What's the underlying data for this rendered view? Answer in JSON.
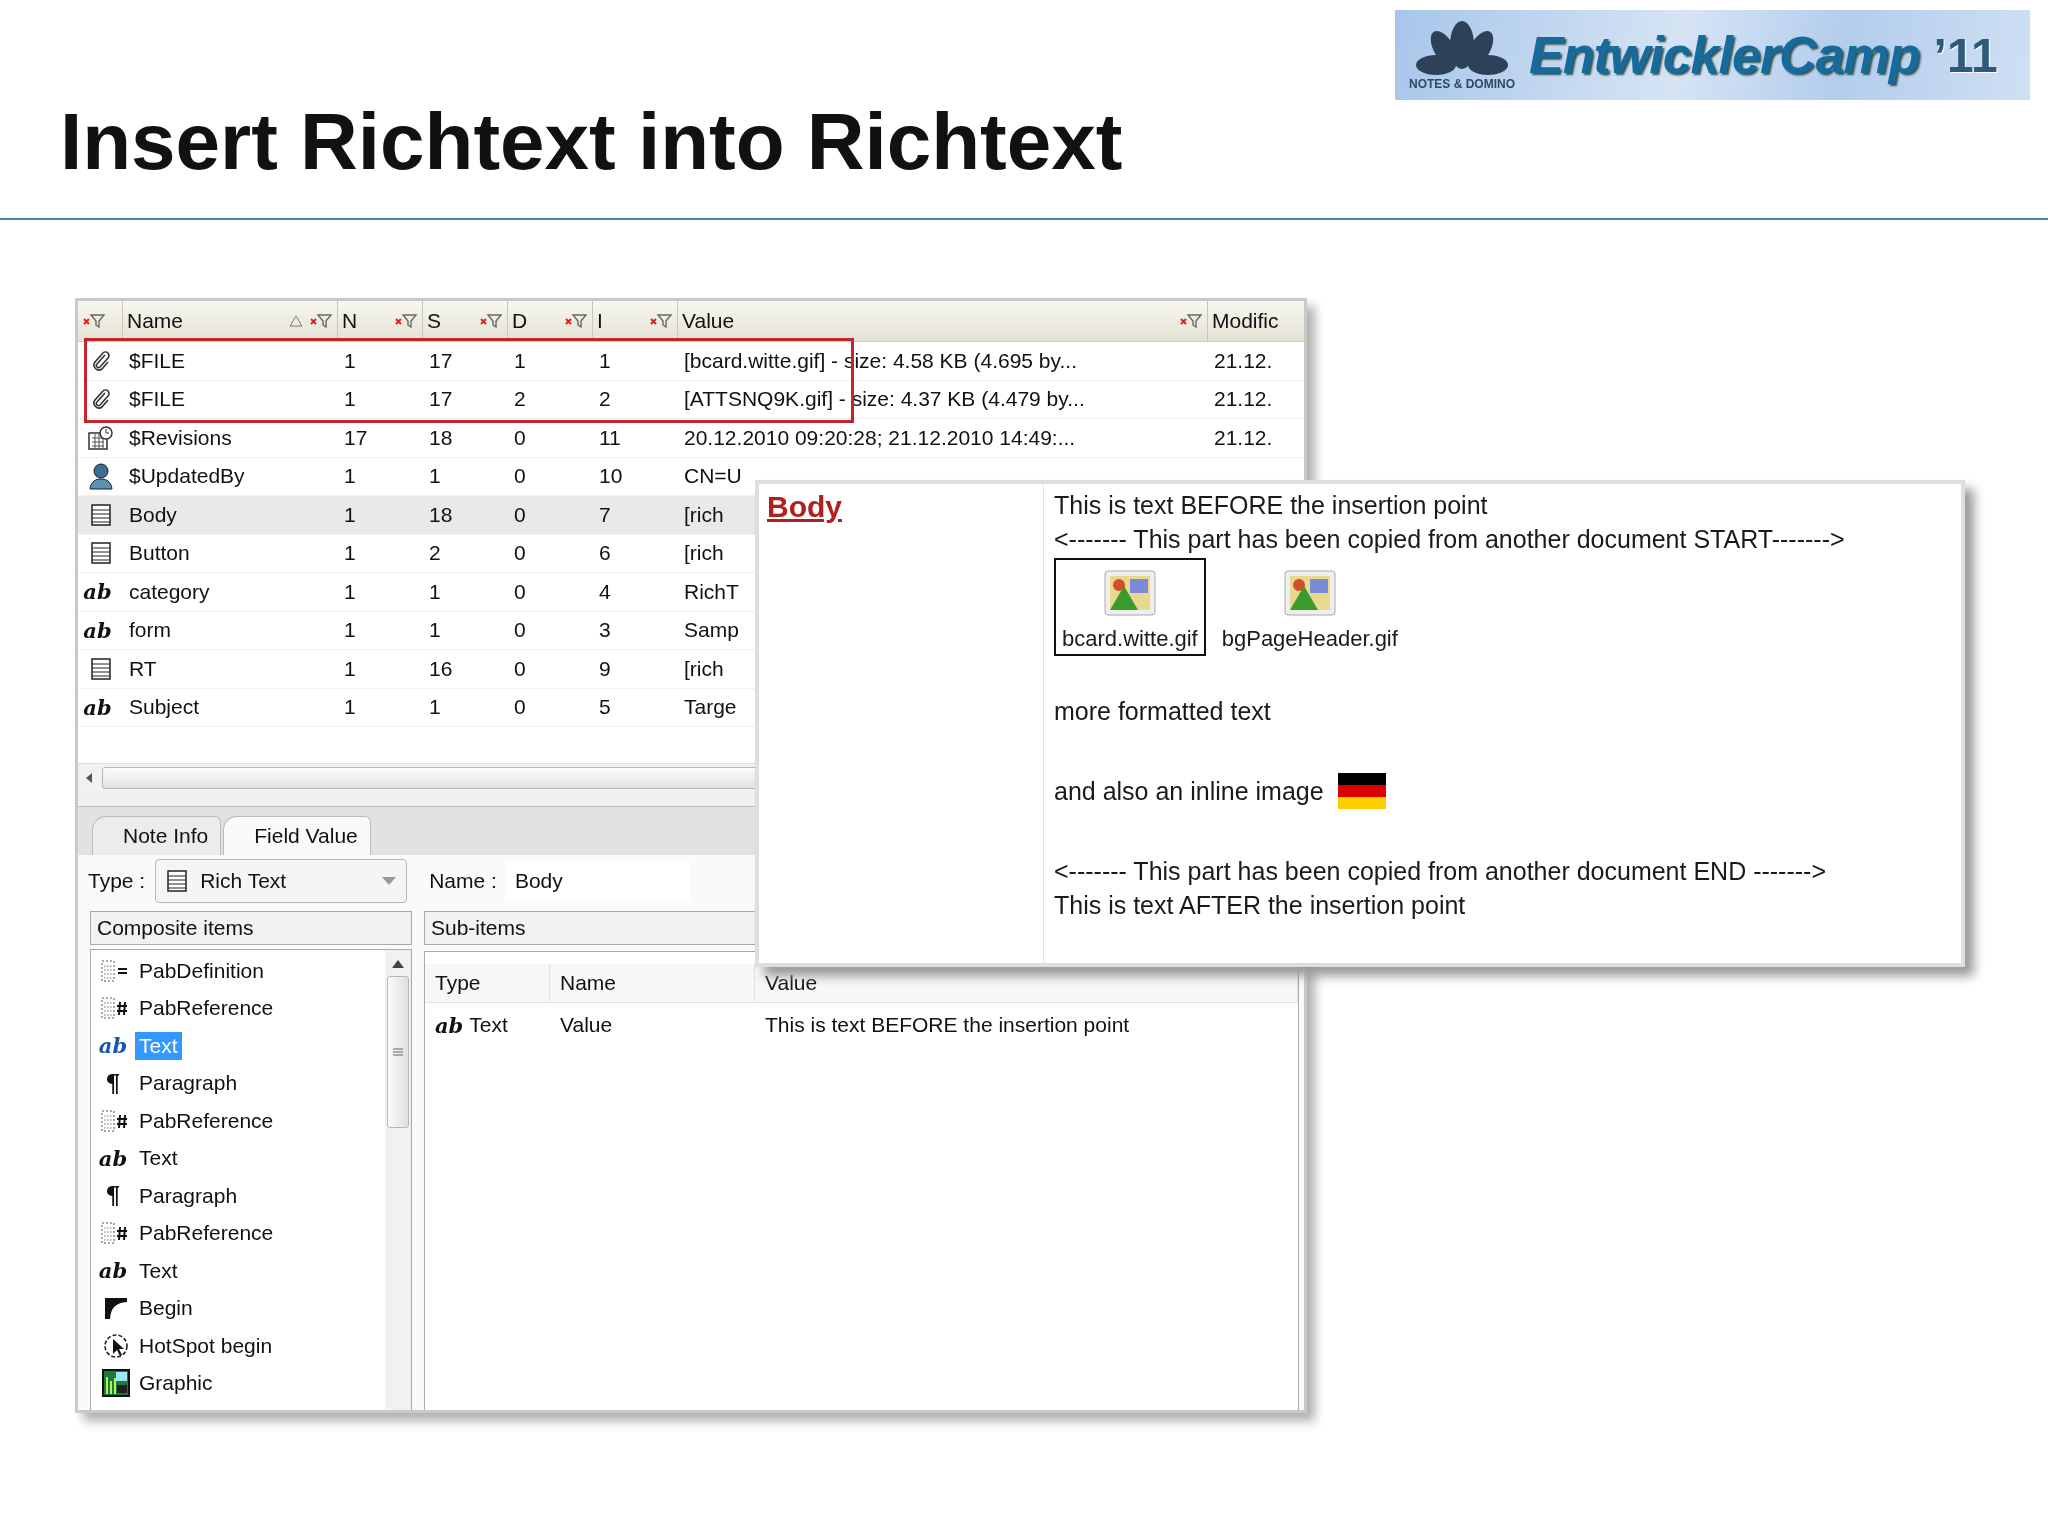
{
  "logo": {
    "brand": "EntwicklerCamp",
    "edition": "’11",
    "tagline": "NOTES & DOMINO"
  },
  "title": "Insert Richtext into Richtext",
  "fields_table": {
    "columns": [
      {
        "label": "Name",
        "sorted": true,
        "filter": true
      },
      {
        "label": "N",
        "sorted": false,
        "filter": true
      },
      {
        "label": "S",
        "sorted": false,
        "filter": true
      },
      {
        "label": "D",
        "sorted": false,
        "filter": true
      },
      {
        "label": "I",
        "sorted": false,
        "filter": true
      },
      {
        "label": "Value",
        "sorted": false,
        "filter": true
      },
      {
        "label": "Modific",
        "sorted": false,
        "filter": false
      }
    ],
    "rows": [
      {
        "kind": "attachment",
        "highlighted": true,
        "selected": false,
        "cells": [
          "$FILE",
          "1",
          "17",
          "1",
          "1",
          "[bcard.witte.gif] - size: 4.58 KB (4.695 by...",
          "21.12."
        ]
      },
      {
        "kind": "attachment",
        "highlighted": true,
        "selected": false,
        "cells": [
          "$FILE",
          "1",
          "17",
          "2",
          "2",
          "[ATTSNQ9K.gif] - size: 4.37 KB (4.479 by...",
          "21.12."
        ]
      },
      {
        "kind": "revisions",
        "highlighted": false,
        "selected": false,
        "cells": [
          "$Revisions",
          "17",
          "18",
          "0",
          "11",
          "20.12.2010 09:20:28; 21.12.2010 14:49:...",
          "21.12."
        ]
      },
      {
        "kind": "person",
        "highlighted": false,
        "selected": false,
        "cells": [
          "$UpdatedBy",
          "1",
          "1",
          "0",
          "10",
          "CN=U"
        ]
      },
      {
        "kind": "rich_text",
        "highlighted": false,
        "selected": true,
        "cells": [
          "Body",
          "1",
          "18",
          "0",
          "7",
          "[rich"
        ]
      },
      {
        "kind": "rich_text",
        "highlighted": false,
        "selected": false,
        "cells": [
          "Button",
          "1",
          "2",
          "0",
          "6",
          "[rich"
        ]
      },
      {
        "kind": "text",
        "glyph": "ab",
        "highlighted": false,
        "selected": false,
        "cells": [
          "category",
          "1",
          "1",
          "0",
          "4",
          "RichT"
        ]
      },
      {
        "kind": "text",
        "glyph": "ab",
        "highlighted": false,
        "selected": false,
        "cells": [
          "form",
          "1",
          "1",
          "0",
          "3",
          "Samp"
        ]
      },
      {
        "kind": "rich_text",
        "highlighted": false,
        "selected": false,
        "cells": [
          "RT",
          "1",
          "16",
          "0",
          "9",
          "[rich"
        ]
      },
      {
        "kind": "text",
        "glyph": "ab",
        "highlighted": false,
        "selected": false,
        "cells": [
          "Subject",
          "1",
          "1",
          "0",
          "5",
          "Targe"
        ]
      }
    ]
  },
  "tabs": [
    {
      "label": "Note Info",
      "selected": false
    },
    {
      "label": "Field Value",
      "selected": true
    }
  ],
  "type_field": {
    "label": "Type :",
    "value": "Rich Text"
  },
  "name_field": {
    "label": "Name :",
    "value": "Body"
  },
  "composite_items": {
    "title": "Composite items",
    "items": [
      {
        "kind": "pab_definition",
        "label": "PabDefinition",
        "selected": false
      },
      {
        "kind": "pab_reference",
        "label": "PabReference",
        "selected": false
      },
      {
        "kind": "text",
        "glyph": "ab",
        "label": "Text",
        "selected": true
      },
      {
        "kind": "paragraph",
        "glyph": "¶",
        "label": "Paragraph",
        "selected": false
      },
      {
        "kind": "pab_reference",
        "label": "PabReference",
        "selected": false
      },
      {
        "kind": "text",
        "glyph": "ab",
        "label": "Text",
        "selected": false
      },
      {
        "kind": "paragraph",
        "glyph": "¶",
        "label": "Paragraph",
        "selected": false
      },
      {
        "kind": "pab_reference",
        "label": "PabReference",
        "selected": false
      },
      {
        "kind": "text",
        "glyph": "ab",
        "label": "Text",
        "selected": false
      },
      {
        "kind": "begin",
        "label": "Begin",
        "selected": false
      },
      {
        "kind": "hotspot",
        "label": "HotSpot begin",
        "selected": false
      },
      {
        "kind": "graphic",
        "label": "Graphic",
        "selected": false
      }
    ]
  },
  "sub_items": {
    "title": "Sub-items",
    "columns": [
      "Type",
      "Name",
      "Value"
    ],
    "rows": [
      {
        "glyph": "ab",
        "type": "Text",
        "name": "Value",
        "value": "This is text BEFORE the insertion point"
      }
    ]
  },
  "popup": {
    "field": "Body",
    "blocks": [
      {
        "kind": "text",
        "text": "This is text BEFORE the insertion point"
      },
      {
        "kind": "text",
        "text": "<------- This part has been copied from another document  START------->"
      },
      {
        "kind": "attachments",
        "items": [
          {
            "name": "bcard.witte.gif",
            "selected": true
          },
          {
            "name": "bgPageHeader.gif",
            "selected": false
          }
        ]
      },
      {
        "kind": "blank"
      },
      {
        "kind": "text",
        "text": "more formatted text"
      },
      {
        "kind": "blank"
      },
      {
        "kind": "inline_image",
        "text": "and also an inline image"
      },
      {
        "kind": "blank"
      },
      {
        "kind": "text",
        "text": "<------- This part has been copied from another document END ------->"
      },
      {
        "kind": "text",
        "text": "This is text  AFTER the insertion point"
      }
    ]
  }
}
